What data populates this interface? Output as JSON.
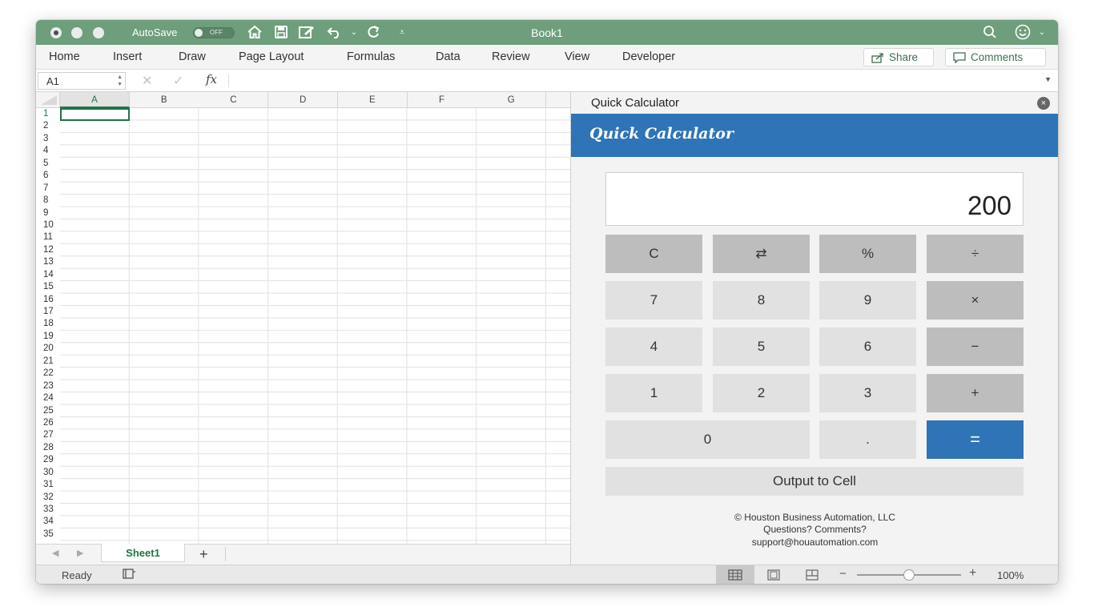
{
  "titlebar": {
    "autosave_label": "AutoSave",
    "autosave_state": "OFF",
    "document_title": "Book1"
  },
  "ribbon": {
    "tabs": [
      "Home",
      "Insert",
      "Draw",
      "Page Layout",
      "Formulas",
      "Data",
      "Review",
      "View",
      "Developer"
    ],
    "share_label": "Share",
    "comments_label": "Comments"
  },
  "formula_bar": {
    "name_box": "A1",
    "fx_label": "fx",
    "formula": ""
  },
  "grid": {
    "columns": [
      "A",
      "B",
      "C",
      "D",
      "E",
      "F",
      "G"
    ],
    "active_column": "A",
    "rows": [
      "1",
      "2",
      "3",
      "4",
      "5",
      "6",
      "7",
      "8",
      "9",
      "10",
      "11",
      "12",
      "13",
      "14",
      "15",
      "16",
      "17",
      "18",
      "19",
      "20",
      "21",
      "22",
      "23",
      "24",
      "25",
      "26",
      "27",
      "28",
      "29",
      "30",
      "31",
      "32",
      "33",
      "34",
      "35"
    ],
    "active_row": "1"
  },
  "sheet_tabs": {
    "active": "Sheet1",
    "add_label": "+"
  },
  "statusbar": {
    "status": "Ready",
    "zoom": "100%",
    "zoom_minus": "−",
    "zoom_plus": "+"
  },
  "task_pane": {
    "header_title": "Quick Calculator",
    "close_symbol": "×",
    "banner_title": "Quick Calculator",
    "display_value": "200",
    "keys": {
      "clear": "C",
      "sign": "⇄",
      "percent": "%",
      "divide": "÷",
      "seven": "7",
      "eight": "8",
      "nine": "9",
      "multiply": "×",
      "four": "4",
      "five": "5",
      "six": "6",
      "minus": "−",
      "one": "1",
      "two": "2",
      "three": "3",
      "plus": "+",
      "zero": "0",
      "decimal": ".",
      "equals": "="
    },
    "output_button": "Output to Cell",
    "footer": {
      "copyright": "© Houston Business Automation, LLC",
      "questions": "Questions? Comments?",
      "email": "support@houautomation.com"
    }
  },
  "colors": {
    "titlebar": "#6e9e7c",
    "excel_green": "#217346",
    "calc_blue": "#2e74b7",
    "key_light": "#e1e1e1",
    "key_dark": "#bdbdbd"
  }
}
